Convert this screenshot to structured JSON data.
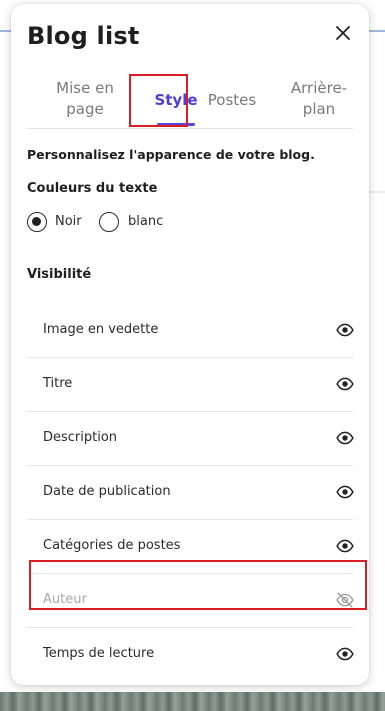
{
  "panel": {
    "title": "Blog list",
    "close_icon": "close-icon"
  },
  "tabs": [
    {
      "label_line1": "Mise en",
      "label_line2": "page",
      "active": false
    },
    {
      "label_line1": "Style",
      "label_line2": "",
      "active": true
    },
    {
      "label_line1": "Postes",
      "label_line2": "",
      "active": false
    },
    {
      "label_line1": "Arrière-",
      "label_line2": "plan",
      "active": false
    }
  ],
  "description": "Personnalisez l'apparence de votre blog.",
  "text_colors": {
    "label": "Couleurs du texte",
    "options": [
      {
        "label": "Noir",
        "selected": true
      },
      {
        "label": "blanc",
        "selected": false
      }
    ]
  },
  "visibility": {
    "label": "Visibilité",
    "items": [
      {
        "label": "Image en vedette",
        "visible": true,
        "icon": "eye-icon"
      },
      {
        "label": "Titre",
        "visible": true,
        "icon": "eye-icon"
      },
      {
        "label": "Description",
        "visible": true,
        "icon": "eye-icon"
      },
      {
        "label": "Date de publication",
        "visible": true,
        "icon": "eye-icon"
      },
      {
        "label": "Catégories de postes",
        "visible": true,
        "icon": "eye-icon"
      },
      {
        "label": "Auteur",
        "visible": false,
        "icon": "eye-off-icon"
      },
      {
        "label": "Temps de lecture",
        "visible": true,
        "icon": "eye-icon"
      }
    ]
  },
  "colors": {
    "accent": "#5b45e0",
    "highlight": "#d81d24"
  }
}
